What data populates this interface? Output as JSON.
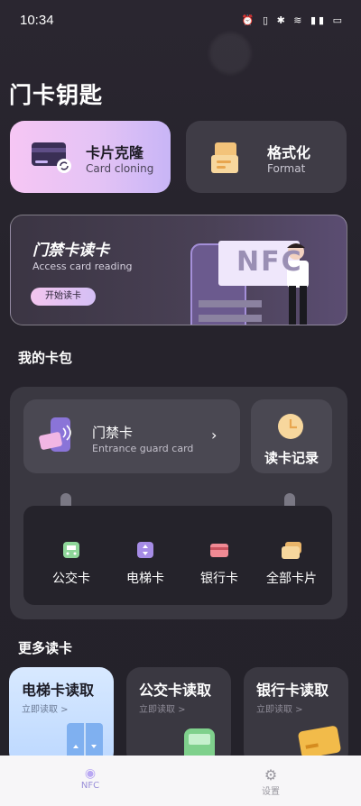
{
  "status": {
    "time": "10:34",
    "icons": "⏰ ▯ ✱ ≋ ▮▮ ▭"
  },
  "page_title": "门卡钥匙",
  "clone_card": {
    "title": "卡片克隆",
    "subtitle": "Card cloning"
  },
  "format_card": {
    "title": "格式化",
    "subtitle": "Format"
  },
  "banner": {
    "title": "门禁卡读卡",
    "subtitle": "Access card reading",
    "button": "开始读卡",
    "nfc": "NFC"
  },
  "wallet": {
    "title": "我的卡包",
    "guard": {
      "title": "门禁卡",
      "subtitle": "Entrance guard card"
    },
    "record": "读卡记录",
    "items": [
      {
        "label": "公交卡",
        "icon": "bus-icon"
      },
      {
        "label": "电梯卡",
        "icon": "elevator-icon"
      },
      {
        "label": "银行卡",
        "icon": "bank-card-icon"
      },
      {
        "label": "全部卡片",
        "icon": "all-cards-icon"
      }
    ]
  },
  "more": {
    "title": "更多读卡",
    "cards": [
      {
        "title": "电梯卡读取",
        "subtitle": "立即读取 >"
      },
      {
        "title": "公交卡读取",
        "subtitle": "立即读取 >"
      },
      {
        "title": "银行卡读取",
        "subtitle": "立即读取 >"
      }
    ]
  },
  "tabs": [
    {
      "label": "NFC",
      "active": true
    },
    {
      "label": "设置",
      "active": false
    }
  ],
  "colors": {
    "accent": "#b9a8f3",
    "pink": "#f6c6f4"
  }
}
